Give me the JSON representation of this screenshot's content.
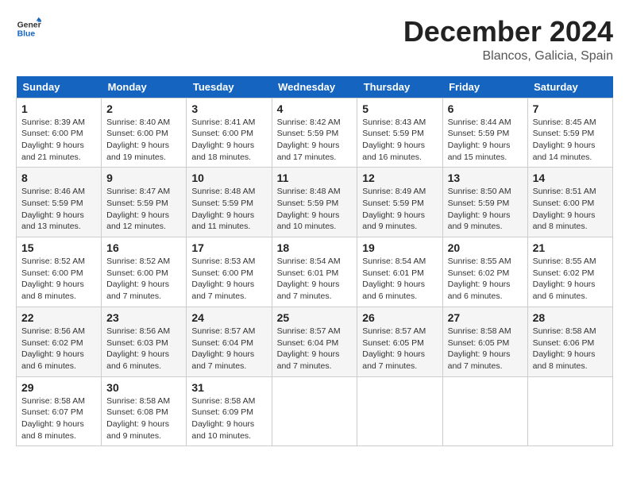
{
  "logo": {
    "general": "General",
    "blue": "Blue"
  },
  "header": {
    "month": "December 2024",
    "location": "Blancos, Galicia, Spain"
  },
  "weekdays": [
    "Sunday",
    "Monday",
    "Tuesday",
    "Wednesday",
    "Thursday",
    "Friday",
    "Saturday"
  ],
  "weeks": [
    [
      {
        "day": "1",
        "sunrise": "8:39 AM",
        "sunset": "6:00 PM",
        "daylight": "9 hours and 21 minutes."
      },
      {
        "day": "2",
        "sunrise": "8:40 AM",
        "sunset": "6:00 PM",
        "daylight": "9 hours and 19 minutes."
      },
      {
        "day": "3",
        "sunrise": "8:41 AM",
        "sunset": "6:00 PM",
        "daylight": "9 hours and 18 minutes."
      },
      {
        "day": "4",
        "sunrise": "8:42 AM",
        "sunset": "5:59 PM",
        "daylight": "9 hours and 17 minutes."
      },
      {
        "day": "5",
        "sunrise": "8:43 AM",
        "sunset": "5:59 PM",
        "daylight": "9 hours and 16 minutes."
      },
      {
        "day": "6",
        "sunrise": "8:44 AM",
        "sunset": "5:59 PM",
        "daylight": "9 hours and 15 minutes."
      },
      {
        "day": "7",
        "sunrise": "8:45 AM",
        "sunset": "5:59 PM",
        "daylight": "9 hours and 14 minutes."
      }
    ],
    [
      {
        "day": "8",
        "sunrise": "8:46 AM",
        "sunset": "5:59 PM",
        "daylight": "9 hours and 13 minutes."
      },
      {
        "day": "9",
        "sunrise": "8:47 AM",
        "sunset": "5:59 PM",
        "daylight": "9 hours and 12 minutes."
      },
      {
        "day": "10",
        "sunrise": "8:48 AM",
        "sunset": "5:59 PM",
        "daylight": "9 hours and 11 minutes."
      },
      {
        "day": "11",
        "sunrise": "8:48 AM",
        "sunset": "5:59 PM",
        "daylight": "9 hours and 10 minutes."
      },
      {
        "day": "12",
        "sunrise": "8:49 AM",
        "sunset": "5:59 PM",
        "daylight": "9 hours and 9 minutes."
      },
      {
        "day": "13",
        "sunrise": "8:50 AM",
        "sunset": "5:59 PM",
        "daylight": "9 hours and 9 minutes."
      },
      {
        "day": "14",
        "sunrise": "8:51 AM",
        "sunset": "6:00 PM",
        "daylight": "9 hours and 8 minutes."
      }
    ],
    [
      {
        "day": "15",
        "sunrise": "8:52 AM",
        "sunset": "6:00 PM",
        "daylight": "9 hours and 8 minutes."
      },
      {
        "day": "16",
        "sunrise": "8:52 AM",
        "sunset": "6:00 PM",
        "daylight": "9 hours and 7 minutes."
      },
      {
        "day": "17",
        "sunrise": "8:53 AM",
        "sunset": "6:00 PM",
        "daylight": "9 hours and 7 minutes."
      },
      {
        "day": "18",
        "sunrise": "8:54 AM",
        "sunset": "6:01 PM",
        "daylight": "9 hours and 7 minutes."
      },
      {
        "day": "19",
        "sunrise": "8:54 AM",
        "sunset": "6:01 PM",
        "daylight": "9 hours and 6 minutes."
      },
      {
        "day": "20",
        "sunrise": "8:55 AM",
        "sunset": "6:02 PM",
        "daylight": "9 hours and 6 minutes."
      },
      {
        "day": "21",
        "sunrise": "8:55 AM",
        "sunset": "6:02 PM",
        "daylight": "9 hours and 6 minutes."
      }
    ],
    [
      {
        "day": "22",
        "sunrise": "8:56 AM",
        "sunset": "6:02 PM",
        "daylight": "9 hours and 6 minutes."
      },
      {
        "day": "23",
        "sunrise": "8:56 AM",
        "sunset": "6:03 PM",
        "daylight": "9 hours and 6 minutes."
      },
      {
        "day": "24",
        "sunrise": "8:57 AM",
        "sunset": "6:04 PM",
        "daylight": "9 hours and 7 minutes."
      },
      {
        "day": "25",
        "sunrise": "8:57 AM",
        "sunset": "6:04 PM",
        "daylight": "9 hours and 7 minutes."
      },
      {
        "day": "26",
        "sunrise": "8:57 AM",
        "sunset": "6:05 PM",
        "daylight": "9 hours and 7 minutes."
      },
      {
        "day": "27",
        "sunrise": "8:58 AM",
        "sunset": "6:05 PM",
        "daylight": "9 hours and 7 minutes."
      },
      {
        "day": "28",
        "sunrise": "8:58 AM",
        "sunset": "6:06 PM",
        "daylight": "9 hours and 8 minutes."
      }
    ],
    [
      {
        "day": "29",
        "sunrise": "8:58 AM",
        "sunset": "6:07 PM",
        "daylight": "9 hours and 8 minutes."
      },
      {
        "day": "30",
        "sunrise": "8:58 AM",
        "sunset": "6:08 PM",
        "daylight": "9 hours and 9 minutes."
      },
      {
        "day": "31",
        "sunrise": "8:58 AM",
        "sunset": "6:09 PM",
        "daylight": "9 hours and 10 minutes."
      },
      null,
      null,
      null,
      null
    ]
  ],
  "labels": {
    "sunrise": "Sunrise:",
    "sunset": "Sunset:",
    "daylight": "Daylight:"
  }
}
